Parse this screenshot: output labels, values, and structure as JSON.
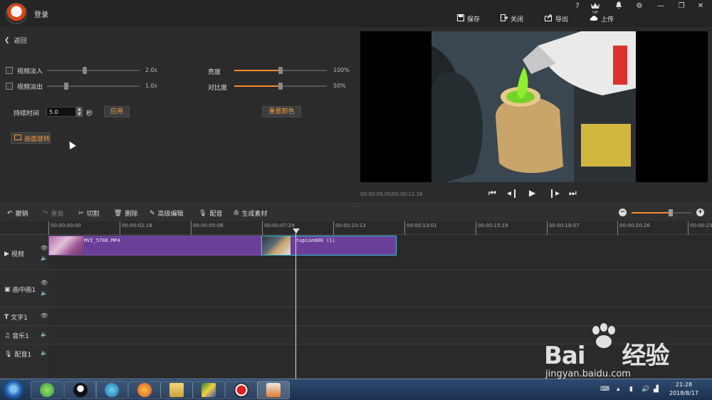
{
  "titlebar": {
    "login": "登录",
    "vip": "VIP",
    "save": "保存",
    "close": "关闭",
    "export": "导出",
    "upload": "上传"
  },
  "left": {
    "back": "返回",
    "fade_in": {
      "label": "视频淡入",
      "value": "2.0s",
      "level": 0.5
    },
    "fade_out": {
      "label": "视频淡出",
      "value": "1.0s",
      "level": 0.25
    },
    "brightness": {
      "label": "亮度",
      "value": "100%",
      "level": 0.5
    },
    "contrast": {
      "label": "对比度",
      "value": "50%",
      "level": 0.5
    },
    "duration_label": "持续时间",
    "duration_value": "5.0",
    "duration_unit": "秒",
    "apply": "应用",
    "reset_color": "重置颜色",
    "rotate": "画面旋转"
  },
  "preview": {
    "time": "00:00:09.05/00:00:12.26"
  },
  "toolbar": {
    "undo": "撤销",
    "redo": "重做",
    "cut": "切割",
    "delete": "删除",
    "advanced": "高级编辑",
    "dub": "配音",
    "generate": "生成素材",
    "zoom_level": 0.65
  },
  "ruler": {
    "ticks": [
      "00:00:00:00",
      "00:00:02:18",
      "00:00:05:06",
      "00:00:07:24",
      "00:00:10:13",
      "00:00:13:01",
      "00:00:15:19",
      "00:00:18:07",
      "00:00:20:26",
      "00:00:23:"
    ]
  },
  "tracks": {
    "video": "视频",
    "pip": "画中画1",
    "text": "文字1",
    "music": "音乐1",
    "dub": "配音1",
    "clip1": "MVI_5700.MP4",
    "clip2": "tupian000 (1)"
  },
  "taskbar": {
    "time": "21:28",
    "date": "2018/8/17"
  },
  "watermark": {
    "brand": "Bai",
    "brand2": "经验",
    "url": "jingyan.baidu.com"
  }
}
